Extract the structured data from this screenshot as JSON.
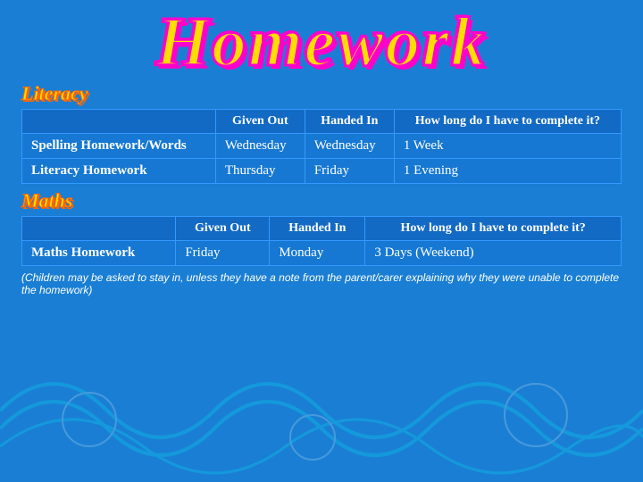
{
  "title": "Homework",
  "literacy": {
    "section_title": "Literacy",
    "headers": [
      "Given Out",
      "Handed In",
      "How long do I have to complete it?"
    ],
    "rows": [
      {
        "subject": "Spelling Homework/Words",
        "given_out": "Wednesday",
        "handed_in": "Wednesday",
        "duration": "1 Week"
      },
      {
        "subject": "Literacy Homework",
        "given_out": "Thursday",
        "handed_in": "Friday",
        "duration": "1 Evening"
      }
    ]
  },
  "maths": {
    "section_title": "Maths",
    "headers": [
      "Given Out",
      "Handed In",
      "How long do I have to complete it?"
    ],
    "rows": [
      {
        "subject": "Maths Homework",
        "given_out": "Friday",
        "handed_in": "Monday",
        "duration": "3 Days (Weekend)"
      }
    ]
  },
  "footer": "(Children may be asked to stay in, unless they have a note from the parent/carer explaining why they were unable to complete the homework)"
}
